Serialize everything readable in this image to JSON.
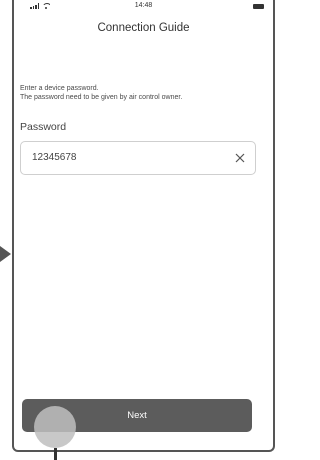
{
  "status_bar": {
    "time": "14:48",
    "signal_icon": "signal-icon",
    "wifi_icon": "wifi-icon",
    "battery_icon": "battery-icon"
  },
  "header": {
    "title": "Connection Guide"
  },
  "instructions": {
    "line1": "Enter a device password.",
    "line2": "The password need to be given by air control owner."
  },
  "password_field": {
    "label": "Password",
    "value": "12345678",
    "clear_icon": "clear-icon"
  },
  "footer": {
    "next_label": "Next"
  },
  "colors": {
    "button": "#5c5c5c",
    "frame": "#555555",
    "border": "#cfcfcf",
    "text": "#444444"
  }
}
